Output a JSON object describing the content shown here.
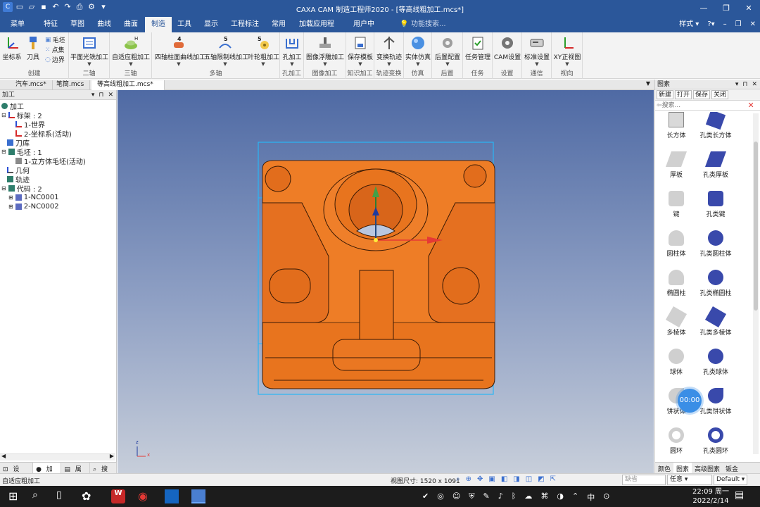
{
  "app": {
    "title": "CAXA CAM 制造工程师2020 - [等高线粗加工.mcs*]"
  },
  "menubar": {
    "tabs": [
      "菜单",
      "特征",
      "草图",
      "曲线",
      "曲面",
      "制造",
      "工具",
      "显示",
      "工程标注",
      "常用",
      "加载应用程序",
      "用户中心"
    ],
    "active_tab": "制造",
    "search_placeholder": "功能搜索...",
    "style_label": "样式"
  },
  "ribbon": {
    "groups": {
      "create": "创建",
      "two_axis": "二轴",
      "three_axis": "三轴",
      "multi_axis": "多轴",
      "hole": "孔加工",
      "relief": "图像加工",
      "knowledge": "知识加工",
      "transform": "轨迹变换",
      "simulation": "仿真",
      "post": "后置",
      "task": "任务",
      "settings": "设置",
      "comm": "通信",
      "view": "视向"
    },
    "buttons": {
      "coord": "坐标系",
      "tool": "刀具",
      "blank": "毛坯",
      "pointset": "点集",
      "boundary": "边界",
      "plane_mill": "平面光铣加工",
      "adaptive_rough": "自适应粗加工",
      "four_axis_cyl": "四轴柱面曲线加工",
      "five_axis_limit": "五轴限制线加工",
      "impeller_rough": "叶轮粗加工",
      "hole_mach": "孔加工",
      "image_relief": "图像浮雕加工",
      "save_template": "保存模板",
      "transform_path": "变换轨迹",
      "solid_sim": "实体仿真",
      "post_config": "后置配置",
      "task_mgr": "任务管理",
      "cam_settings": "CAM设置",
      "std_settings": "标准设置",
      "xy_view": "XY正视图"
    }
  },
  "doc_tabs": [
    "汽车.mcs*",
    "笔筒.mcs",
    "等高线粗加工.mcs*"
  ],
  "left_panel": {
    "title": "加工",
    "tree": {
      "root": "加工",
      "frame": "标架 : 2",
      "frame_1": "1-世界",
      "frame_2": "2-坐标系(活动)",
      "toolbase": "刀库",
      "blank": "毛坯 : 1",
      "blank_1": "1-立方体毛坯(活动)",
      "geometry": "几何",
      "path": "轨迹",
      "code": "代码 : 2",
      "code_1": "1-NC0001",
      "code_2": "2-NC0002"
    },
    "bottom_tabs": [
      "设计...",
      "加工",
      "属性",
      "搜索"
    ]
  },
  "right_panel": {
    "title": "图素",
    "toolbar": [
      "新建",
      "打开",
      "保存",
      "关闭"
    ],
    "search_placeholder": "搜索...",
    "elements": [
      "长方体",
      "孔类长方体",
      "厚板",
      "孔类厚板",
      "键",
      "孔类键",
      "圆柱体",
      "孔类圆柱体",
      "椭圆柱",
      "孔类椭圆柱",
      "多棱体",
      "孔类多棱体",
      "球体",
      "孔类球体",
      "饼状体",
      "孔类饼状体",
      "圆环",
      "孔类圆环"
    ],
    "bottom_tabs": [
      "颜色",
      "图素",
      "高级图素",
      "钣金"
    ]
  },
  "overlay": {
    "timer": "00:00"
  },
  "viewport": {
    "axis_x": "x",
    "axis_z": "z"
  },
  "statusbar": {
    "left": "自适应粗加工",
    "view_size": "视图尺寸: 1520 x 1091",
    "pick_placeholder": "缺省",
    "mode": "任意",
    "style": "Default"
  },
  "taskbar": {
    "time": "22:09 周一",
    "date": "2022/2/14",
    "ime": "中"
  }
}
